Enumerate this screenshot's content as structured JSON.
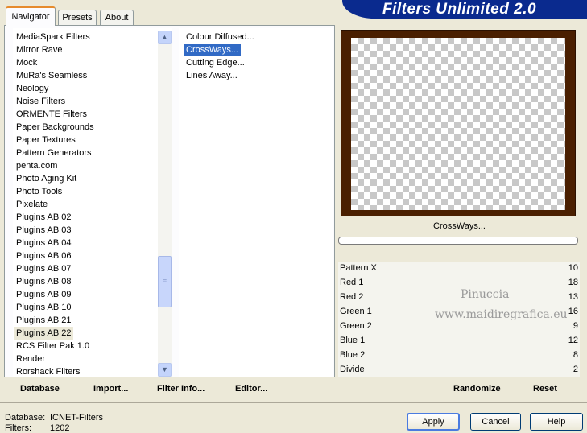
{
  "tabs": [
    "Navigator",
    "Presets",
    "About"
  ],
  "banner_title": "Filters Unlimited 2.0",
  "categories": [
    "MediaSpark Filters",
    "Mirror Rave",
    "Mock",
    "MuRa's Seamless",
    "Neology",
    "Noise Filters",
    "ORMENTE Filters",
    "Paper Backgrounds",
    "Paper Textures",
    "Pattern Generators",
    "penta.com",
    "Photo Aging Kit",
    "Photo Tools",
    "Pixelate",
    "Plugins AB 02",
    "Plugins AB 03",
    "Plugins AB 04",
    "Plugins AB 06",
    "Plugins AB 07",
    "Plugins AB 08",
    "Plugins AB 09",
    "Plugins AB 10",
    "Plugins AB 21",
    "Plugins AB 22",
    "RCS Filter Pak 1.0",
    "Render",
    "Rorshack Filters"
  ],
  "selected_category": "Plugins AB 22",
  "filters": [
    "Colour Diffused...",
    "CrossWays...",
    "Cutting Edge...",
    "Lines Away..."
  ],
  "selected_filter": "CrossWays...",
  "preview_caption": "CrossWays...",
  "params": [
    {
      "label": "Pattern X",
      "value": "10"
    },
    {
      "label": "Red 1",
      "value": "18"
    },
    {
      "label": "Red 2",
      "value": "13"
    },
    {
      "label": "Green 1",
      "value": "16"
    },
    {
      "label": "Green 2",
      "value": "9"
    },
    {
      "label": "Blue 1",
      "value": "12"
    },
    {
      "label": "Blue 2",
      "value": "8"
    },
    {
      "label": "Divide",
      "value": "2"
    }
  ],
  "watermark": {
    "name": "Pinuccia",
    "site": "www.maidiregrafica.eu"
  },
  "bottom_links": [
    "Database",
    "Import...",
    "Filter Info...",
    "Editor..."
  ],
  "randomize_label": "Randomize",
  "reset_label": "Reset",
  "status": {
    "database_label": "Database:",
    "database_value": "ICNET-Filters",
    "filters_label": "Filters:",
    "filters_value": "1202"
  },
  "buttons": {
    "apply": "Apply",
    "cancel": "Cancel",
    "help": "Help"
  },
  "colors": {
    "banner": "#0a2a8e",
    "selection": "#316ac5",
    "preview_frame": "#4a1f00",
    "window_bg": "#ece9d8"
  }
}
